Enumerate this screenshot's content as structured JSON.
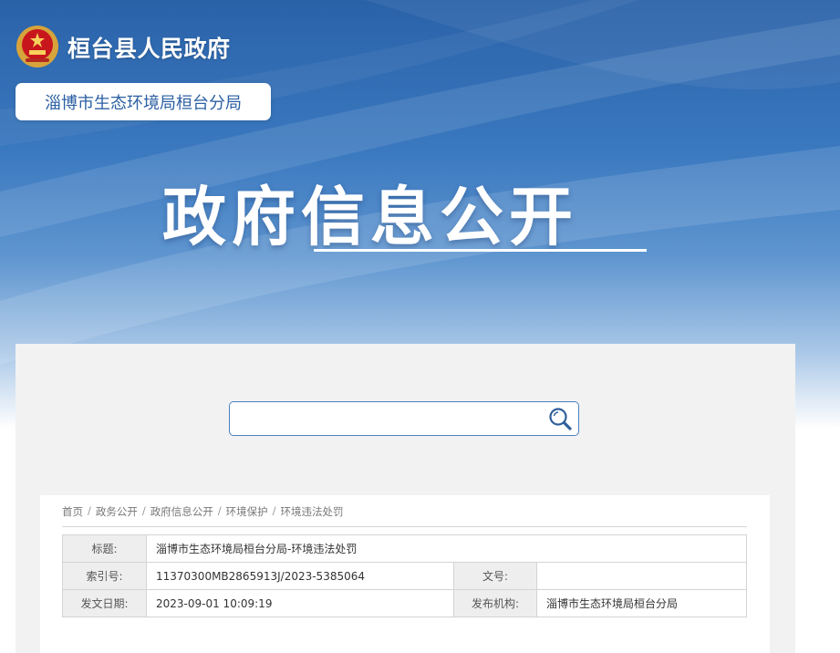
{
  "header": {
    "site_name": "桓台县人民政府",
    "department": "淄博市生态环境局桓台分局",
    "hero_title": "政府信息公开"
  },
  "search": {
    "placeholder": "",
    "value": ""
  },
  "breadcrumb": [
    {
      "label": "首页"
    },
    {
      "label": "政务公开"
    },
    {
      "label": "政府信息公开"
    },
    {
      "label": "环境保护"
    },
    {
      "label": "环境违法处罚"
    }
  ],
  "meta": {
    "title_label": "标题:",
    "title_value": "淄博市生态环境局桓台分局-环境违法处罚",
    "index_label": "索引号:",
    "index_value": "11370300MB2865913J/2023-5385064",
    "doc_label": "文号:",
    "doc_value": "",
    "date_label": "发文日期:",
    "date_value": "2023-09-01 10:09:19",
    "org_label": "发布机构:",
    "org_value": "淄博市生态环境局桓台分局"
  },
  "colors": {
    "accent": "#2b5fa3",
    "banner_top": "#2a62a8"
  }
}
